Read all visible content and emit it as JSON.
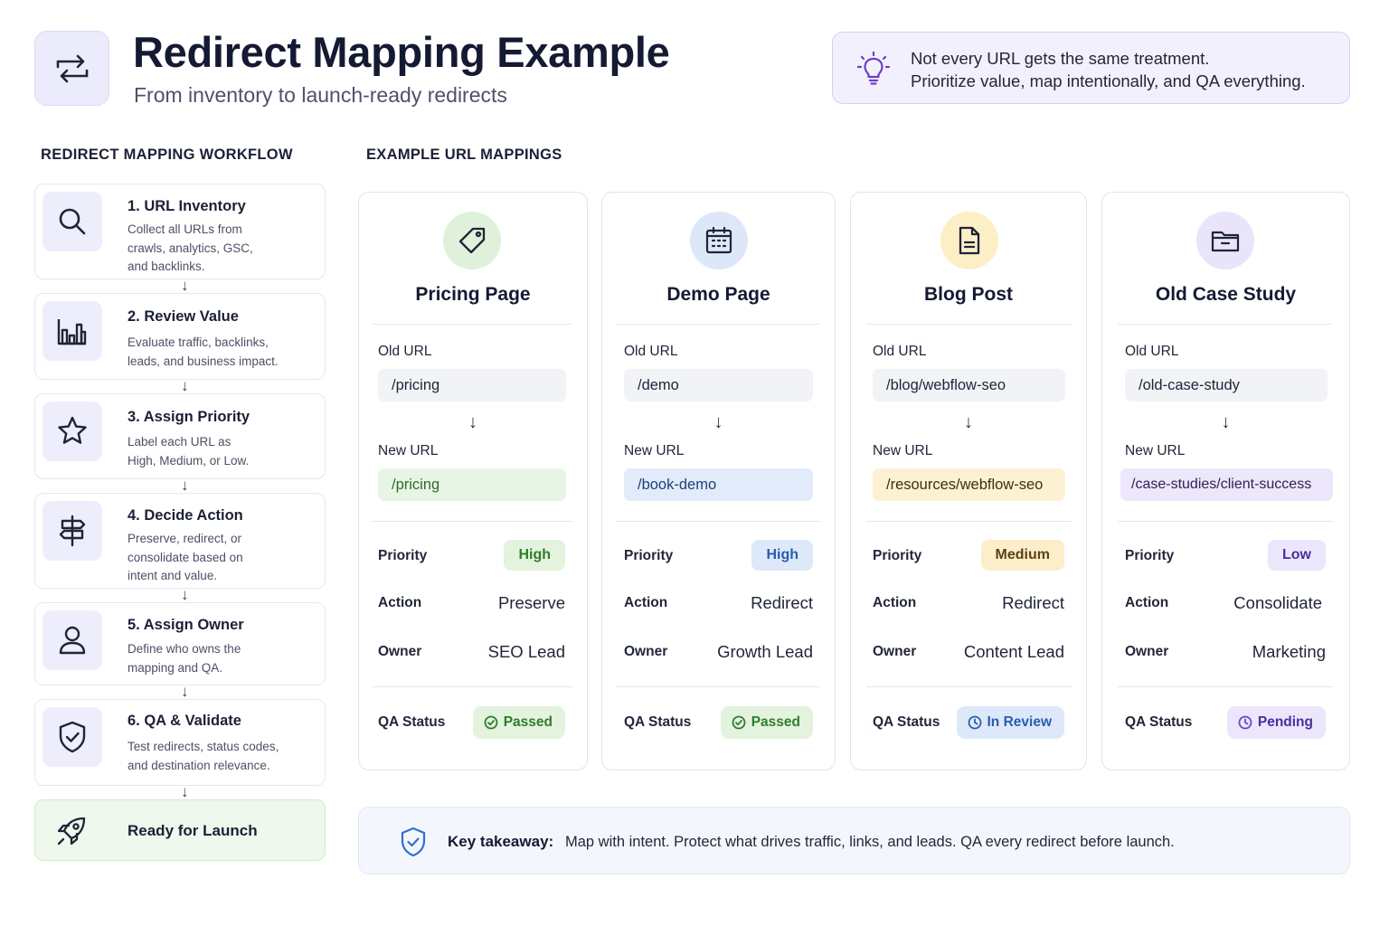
{
  "header": {
    "title": "Redirect Mapping Example",
    "subtitle": "From inventory to launch-ready redirects",
    "logo_icon": "swap-arrows-icon"
  },
  "tip": {
    "icon": "lightbulb-icon",
    "line1": "Not every URL gets the same treatment.",
    "line2": "Prioritize value, map intentionally, and QA everything."
  },
  "workflow": {
    "heading": "REDIRECT MAPPING WORKFLOW",
    "steps": [
      {
        "title": "1. URL Inventory",
        "icon": "search-icon",
        "desc": [
          "Collect all URLs from",
          "crawls, analytics, GSC,",
          "and backlinks."
        ]
      },
      {
        "title": "2. Review Value",
        "icon": "bar-chart-icon",
        "desc": [
          "Evaluate traffic, backlinks,",
          "leads, and business impact."
        ]
      },
      {
        "title": "3. Assign Priority",
        "icon": "star-icon",
        "desc": [
          "Label each URL as",
          "High, Medium, or Low."
        ]
      },
      {
        "title": "4. Decide Action",
        "icon": "signpost-icon",
        "desc": [
          "Preserve, redirect, or",
          "consolidate based on",
          "intent and value."
        ]
      },
      {
        "title": "5. Assign Owner",
        "icon": "user-icon",
        "desc": [
          "Define who owns the",
          "mapping and QA."
        ]
      },
      {
        "title": "6. QA & Validate",
        "icon": "shield-check-icon",
        "desc": [
          "Test redirects, status codes,",
          "and destination relevance."
        ]
      }
    ],
    "launch": {
      "label": "Ready for Launch",
      "icon": "rocket-icon"
    },
    "arrow": "↓"
  },
  "mappings": {
    "heading": "EXAMPLE URL MAPPINGS",
    "labels": {
      "old_url": "Old URL",
      "new_url": "New URL",
      "priority": "Priority",
      "action": "Action",
      "owner": "Owner",
      "qa_status": "QA Status",
      "arrow": "↓"
    },
    "cards": [
      {
        "title": "Pricing Page",
        "icon": "tag-icon",
        "old_url": "/pricing",
        "new_url": "/pricing",
        "priority": "High",
        "action": "Preserve",
        "owner": "SEO Lead",
        "qa_status": "Passed",
        "qa_icon": "check-circle-icon",
        "accent": "#3b9a3a"
      },
      {
        "title": "Demo Page",
        "icon": "calendar-icon",
        "old_url": "/demo",
        "new_url": "/book-demo",
        "priority": "High",
        "action": "Redirect",
        "owner": "Growth Lead",
        "qa_status": "Passed",
        "qa_icon": "check-circle-icon",
        "accent": "#2f6fd1"
      },
      {
        "title": "Blog Post",
        "icon": "document-icon",
        "old_url": "/blog/webflow-seo",
        "new_url": "/resources/webflow-seo",
        "priority": "Medium",
        "action": "Redirect",
        "owner": "Content Lead",
        "qa_status": "In Review",
        "qa_icon": "clock-icon",
        "accent": "#c8962a"
      },
      {
        "title": "Old Case Study",
        "icon": "folder-icon",
        "old_url": "/old-case-study",
        "new_url": "/case-studies/client-success",
        "priority": "Low",
        "action": "Consolidate",
        "owner": "Marketing",
        "qa_status": "Pending",
        "qa_icon": "clock-icon",
        "accent": "#6b45c8"
      }
    ]
  },
  "takeaway": {
    "icon": "shield-check-icon",
    "label": "Key takeaway:",
    "text": "Map with intent. Protect what drives traffic, links, and leads. QA every redirect before launch."
  },
  "colors": {
    "green_bg": "#e6f4e2",
    "green_text": "#2f7d2c",
    "blue_bg": "#e2ecfa",
    "blue_text": "#2a5db0",
    "yellow_bg": "#fdf0cf",
    "yellow_text": "#6b4e10",
    "purple_bg": "#ece7fb",
    "purple_text": "#4b2e9e"
  }
}
